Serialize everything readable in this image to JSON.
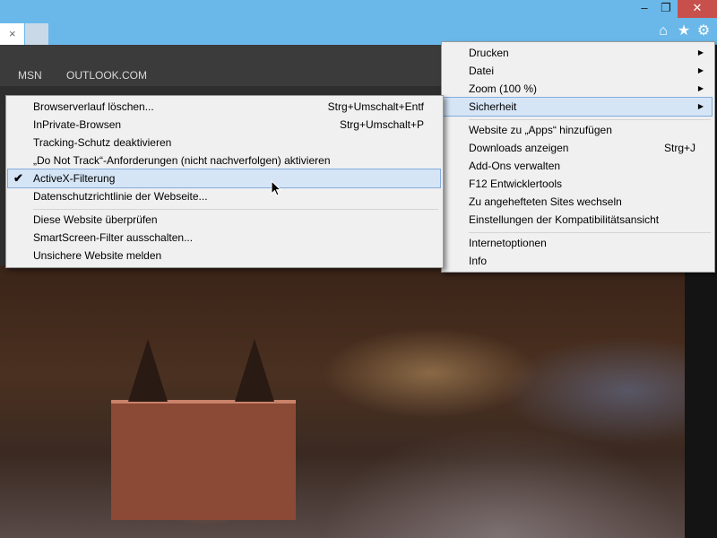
{
  "titlebar": {
    "tab_close": "×",
    "window_controls": {
      "minimize": "–",
      "maximize": "❐",
      "close": "✕"
    },
    "toolbar_icons": {
      "home": "⌂",
      "favorites": "★",
      "tools": "⚙"
    }
  },
  "page": {
    "nav": {
      "msn": "MSN",
      "outlook": "OUTLOOK.COM"
    }
  },
  "main_menu": {
    "items": [
      {
        "label": "Drucken",
        "arrow": "▶"
      },
      {
        "label": "Datei",
        "arrow": "▶"
      },
      {
        "label": "Zoom (100 %)",
        "arrow": "▶"
      },
      {
        "label": "Sicherheit",
        "arrow": "▶"
      },
      {
        "label": "Website zu „Apps“ hinzufügen"
      },
      {
        "label": "Downloads anzeigen",
        "shortcut": "Strg+J"
      },
      {
        "label": "Add-Ons verwalten"
      },
      {
        "label": "F12 Entwicklertools"
      },
      {
        "label": "Zu angehefteten Sites wechseln"
      },
      {
        "label": "Einstellungen der Kompatibilitätsansicht"
      },
      {
        "label": "Internetoptionen"
      },
      {
        "label": "Info"
      }
    ]
  },
  "sub_menu": {
    "check_mark": "✔",
    "items": [
      {
        "label": "Browserverlauf löschen...",
        "shortcut": "Strg+Umschalt+Entf"
      },
      {
        "label": "InPrivate-Browsen",
        "shortcut": "Strg+Umschalt+P"
      },
      {
        "label": "Tracking-Schutz deaktivieren"
      },
      {
        "label": "„Do Not Track“-Anforderungen (nicht nachverfolgen) aktivieren"
      },
      {
        "label": "ActiveX-Filterung",
        "checked": true
      },
      {
        "label": "Datenschutzrichtlinie der Webseite..."
      },
      {
        "label": "Diese Website überprüfen"
      },
      {
        "label": "SmartScreen-Filter ausschalten..."
      },
      {
        "label": "Unsichere Website melden"
      }
    ]
  },
  "colors": {
    "titlebar": "#6ab8ea",
    "close_button": "#c7504c",
    "menu_background": "#f0f0f0",
    "highlight": "#d5e5f6",
    "highlight_border": "#84acdd"
  }
}
